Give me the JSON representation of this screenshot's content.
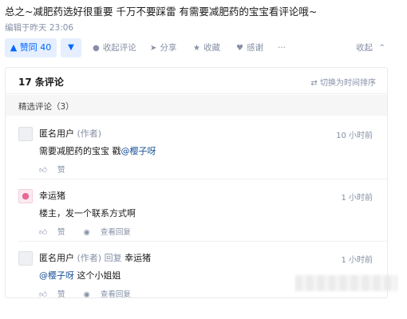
{
  "post": {
    "summary": "总之~减肥药选好很重要 千万不要踩雷 有需要减肥药的宝宝看评论哦~",
    "edited": "编辑于昨天 23:06"
  },
  "actions": {
    "upvote": "赞同 40",
    "comment": "收起评论",
    "share": "分享",
    "favorite": "收藏",
    "thanks": "感谢",
    "more": "···",
    "collapse": "收起"
  },
  "comments_panel": {
    "count": "17 条评论",
    "sort": "切换为时间排序",
    "featured": "精选评论（3）",
    "items": [
      {
        "author": "匿名用户",
        "author_note": "(作者)",
        "reply_word": "",
        "reply_to": "",
        "time": "10 小时前",
        "text": "需要减肥药的宝宝 戳",
        "mention": "@樱子呀",
        "text_after": "",
        "like": "赞",
        "view_replies": ""
      },
      {
        "author": "幸运猪",
        "author_note": "",
        "reply_word": "",
        "reply_to": "",
        "time": "1 小时前",
        "text": "楼主，发一个联系方式啊",
        "mention": "",
        "text_after": "",
        "like": "赞",
        "view_replies": "查看回复"
      },
      {
        "author": "匿名用户",
        "author_note": "(作者)",
        "reply_word": "回复",
        "reply_to": "幸运猪",
        "time": "1 小时前",
        "text": "",
        "mention": "@樱子呀",
        "text_after": " 这个小姐姐",
        "like": "赞",
        "view_replies": "查看回复"
      }
    ]
  },
  "icons": {
    "upvote": "triangle-up-icon",
    "downvote": "triangle-down-icon",
    "comment": "comment-icon",
    "share": "share-icon",
    "favorite": "star-icon",
    "thanks": "heart-icon",
    "collapse": "chevron-up-icon",
    "sort": "swap-icon",
    "like": "thumb-up-icon",
    "replies": "reply-bubble-icon"
  },
  "colors": {
    "accent": "#0066ff",
    "muted": "#8590a6",
    "link": "#175199"
  }
}
